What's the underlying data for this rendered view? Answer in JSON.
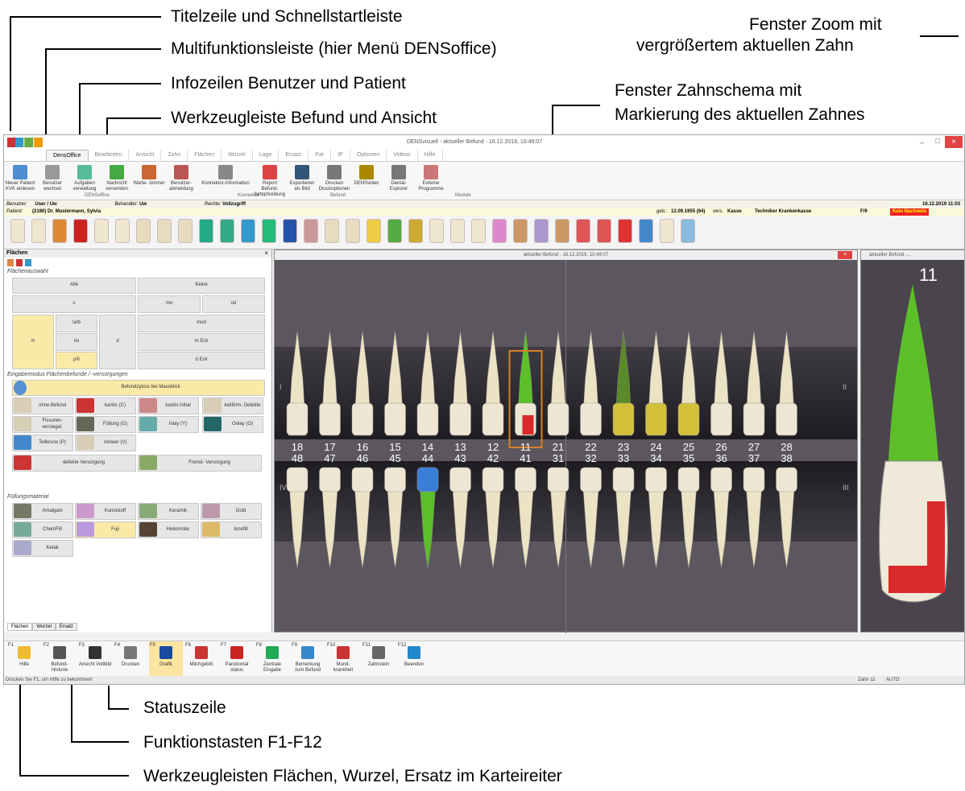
{
  "annotations": {
    "title_bar": "Titelzeile und Schnellstartleiste",
    "ribbon": "Multifunktionsleiste (hier Menü DENSoffice)",
    "info_lines": "Infozeilen Benutzer und Patient",
    "toolbar": "Werkzeugleiste Befund und Ansicht",
    "zoom_line1": "Fenster Zoom mit",
    "zoom_line2": "vergrößertem aktuellen Zahn",
    "chart_line1": "Fenster Zahnschema mit",
    "chart_line2": "Markierung des aktuellen Zahnes",
    "status": "Statuszeile",
    "fkeys": "Funktionstasten F1-F12",
    "tabs": "Werkzeugleisten Flächen, Wurzel, Ersatz im Karteireiter"
  },
  "app": {
    "window_title": "DENSvisuell - aktueller Befund - 16.12.2019, 10:49:07",
    "tabs": [
      "DensOffice",
      "Bearbeiten",
      "Ansicht",
      "Zahn",
      "Flächen",
      "Wurzel",
      "Lage",
      "Ersatz",
      "Par",
      "IP",
      "Optionen",
      "Videos",
      "Hilfe"
    ],
    "ribbon_buttons": [
      "Neuer Patient KVK einlesen",
      "Benutzer wechsel",
      "Aufgaben verwaltung",
      "Nachricht versenden",
      "Warte- zimmer",
      "Benutzer- abmeldung",
      "Konnektor-Information",
      "Report Befund- fortschreibung",
      "Exportieren als Bild",
      "Drucken Druckoptionen",
      "DENSvideo",
      "Dental- Explorer",
      "Externe Programme"
    ],
    "ribbon_groups": [
      "DENSoffice",
      "Konnektor TI",
      "Befund",
      "Module"
    ],
    "user_line": {
      "label": "Benutzer:",
      "user": "User / Uw",
      "treat_label": "Behandler:",
      "treat": "Uw",
      "rights_label": "Rechte:",
      "rights": "Vollzugriff",
      "date": "16.12.2019",
      "time": "11:03"
    },
    "patient_line": {
      "label": "Patient:",
      "name": "(2180) Dr. Mustermann, Sylvia",
      "born_label": "geb.:",
      "born": "12.09.1955 (64)",
      "ins_label": "vers.",
      "ins": "Kasse",
      "kasse": "Techniker Krankenkasse",
      "code": "F/9",
      "warning": "Kein Nachweis"
    },
    "panel": {
      "title": "Flächen",
      "sec1": "Flächenauswahl",
      "surfaces": {
        "alle": "Alle",
        "keine": "Keine",
        "c": "c",
        "mo": "mo",
        "od": "od",
        "lab": "la/b",
        "m": "m",
        "io": "i/o",
        "d": "d",
        "mod": "mod",
        "meck": "m Eck",
        "pli": "p/li",
        "deck": "d Eck"
      },
      "sec2": "Eingabemodus Flächenbefunde / -versorgungen",
      "befundzyklus": "Befundzyklus bei Mausklick",
      "modes": [
        "ohne Befund",
        "kariös (C)",
        "kariös initial",
        "keilförm. Defekte",
        "Fissuren- versiegel.",
        "Füllung (G)",
        "Inlay (Y)",
        "Onlay (O)",
        "Teilkrone (P)",
        "Veneer (V)",
        "defekte Versorgung",
        "Fremd- Versorgung"
      ],
      "sec3": "Füllungsmaterial",
      "materials": [
        "Amalgam",
        "Kunststoff",
        "Keramik",
        "Gold",
        "ChemFill",
        "Fuji",
        "Heliomolar",
        "Ionofill",
        "Ketak"
      ],
      "lower_tabs": [
        "Flächen",
        "Wurzel",
        "Ersatz"
      ]
    },
    "chart": {
      "title": "aktueller Befund - 16.12.2019, 10:49:07",
      "upper": [
        "18",
        "17",
        "16",
        "15",
        "14",
        "13",
        "12",
        "11",
        "21",
        "22",
        "23",
        "24",
        "25",
        "26",
        "27",
        "28"
      ],
      "lower": [
        "48",
        "47",
        "46",
        "45",
        "44",
        "43",
        "42",
        "41",
        "31",
        "32",
        "33",
        "34",
        "35",
        "36",
        "37",
        "38"
      ],
      "quad": [
        "I",
        "II",
        "III",
        "IV"
      ]
    },
    "zoom": {
      "title": "aktueller Befund -...",
      "tooth": "11"
    },
    "fkeys": [
      [
        "F1",
        "Hilfe"
      ],
      [
        "F2",
        "Befund- Historie"
      ],
      [
        "F3",
        "Ansicht Vollbild"
      ],
      [
        "F4",
        "Drucken"
      ],
      [
        "F5",
        "Grafik"
      ],
      [
        "F6",
        "Milchgebiß"
      ],
      [
        "F7",
        "Parodontal status"
      ],
      [
        "F8",
        "Zentrale Eingabe"
      ],
      [
        "F9",
        "Bemerkung zum Befund"
      ],
      [
        "F10",
        "Mund- krankheit"
      ],
      [
        "F11",
        "Zahnstein"
      ],
      [
        "F12",
        "Beenden"
      ]
    ],
    "status": {
      "left": "Drücken Sie F1, um Hilfe zu bekommen!",
      "zahn": "Zahn 11",
      "mode": "AUTO"
    }
  }
}
